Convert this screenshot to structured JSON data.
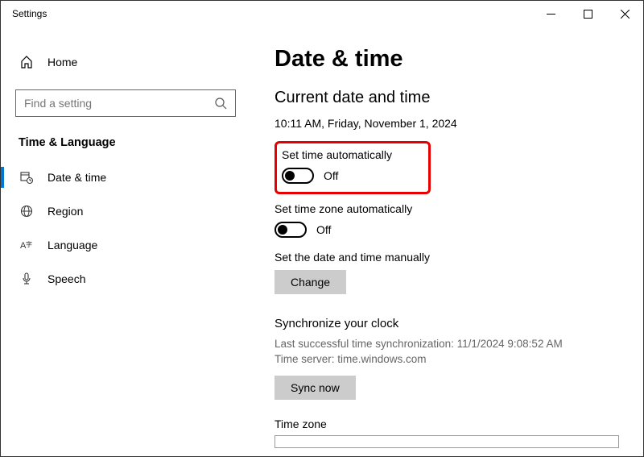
{
  "window": {
    "title": "Settings"
  },
  "sidebar": {
    "home_label": "Home",
    "search_placeholder": "Find a setting",
    "section_label": "Time & Language",
    "items": [
      {
        "label": "Date & time"
      },
      {
        "label": "Region"
      },
      {
        "label": "Language"
      },
      {
        "label": "Speech"
      }
    ]
  },
  "main": {
    "title": "Date & time",
    "current_heading": "Current date and time",
    "current_value": "10:11 AM, Friday, November 1, 2024",
    "set_time_auto": {
      "label": "Set time automatically",
      "state": "Off"
    },
    "set_tz_auto": {
      "label": "Set time zone automatically",
      "state": "Off"
    },
    "manual": {
      "label": "Set the date and time manually",
      "button": "Change"
    },
    "sync": {
      "heading": "Synchronize your clock",
      "last_line": "Last successful time synchronization: 11/1/2024 9:08:52 AM",
      "server_line": "Time server: time.windows.com",
      "button": "Sync now"
    },
    "tz_label": "Time zone"
  }
}
